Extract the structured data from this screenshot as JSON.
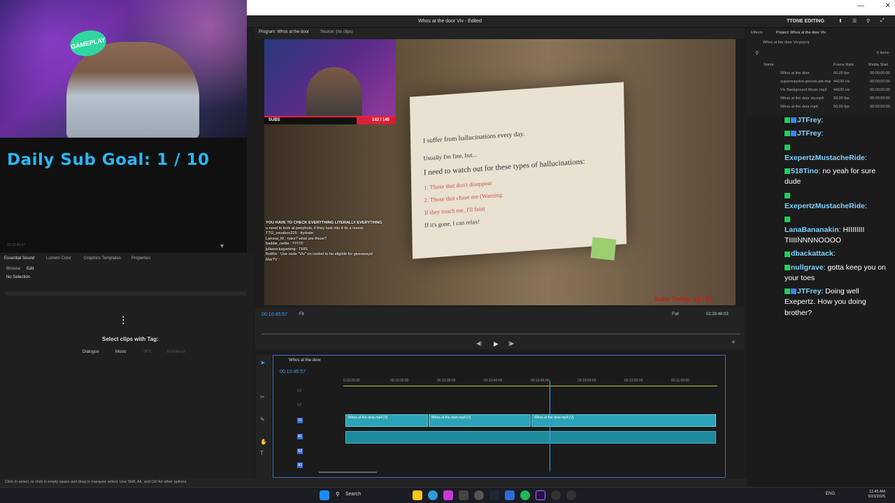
{
  "webcam": {
    "logo_text": "GAMEPLAY",
    "subgoal": "Daily Sub Goal:  1 / 10"
  },
  "left_timecode": "00:10:45:57",
  "window": {
    "title": "Whos at the door Viv - Edited",
    "workspace": "TTONE EDITING"
  },
  "program_monitor": {
    "tab_program": "Program: Whos at the door",
    "tab_source": "Source: (no clips)",
    "timecode": "00:10:45:57",
    "fit": "Fit",
    "quality": "Full",
    "duration": "01:26:48:03"
  },
  "overlay": {
    "subs_label": "SUBS",
    "subs_count": "143 / 145",
    "note_lines": [
      "I suffer from hallucinations every day.",
      "Usually I'm fine, but...",
      "I need to watch out for these types of hallucinations:",
      "1. Those that don't disappear",
      "2. Those that chase me (Warning",
      "If they touch me, I'll faint",
      "If it's gone, I can relax!"
    ],
    "subs_today": "Subs Today: 11 / 20",
    "chat_lines": [
      "YOU HAVE TO CHECK EVERYTHING LITERALLY EVERYTHING",
      "u need to look at peephole, if they look into it its a noooo",
      "TTG_zavaboo225 : ttydrate",
      "Larissa_M : rules? what are those?",
      "baddie_nettie : !!!!!!!!!!",
      "juliasocksgaming : THIS",
      "BotRix : Use code \"Viv\" on roobet to be eligible for giveaways!",
      "MarTV : "
    ]
  },
  "essential_sound": {
    "tabs": [
      "Essential Sound",
      "Lumetri Color",
      "Graphics Templates",
      "Properties"
    ],
    "subtabs": [
      "Browse",
      "Edit"
    ],
    "no_selection": "No Selection",
    "select_text": "Select clips with Tag:",
    "tags": [
      "Dialogue",
      "Music",
      "SFX",
      "Ambience"
    ]
  },
  "project": {
    "tabs": [
      "Effects",
      "Project: Whos at the door Viv"
    ],
    "file": "Whos at the door Viv.prproj",
    "items_count": "5 items",
    "columns": [
      "Name",
      "Frame Rate",
      "Media Start"
    ],
    "rows": [
      [
        "Whos at the door",
        "60.00 fps",
        "00:00:00:00"
      ],
      [
        "supermassive-person-ple-mai",
        "44100 Hz",
        "00:00:00:00"
      ],
      [
        "Viv Background Music.mp3",
        "44100 Hz",
        "00:00:00:00"
      ],
      [
        "Whos at the door viv.mp4",
        "60.00 fps",
        "00:00:00:00"
      ],
      [
        "Whos at the door.mp4",
        "60.00 fps",
        "00:00:00:00"
      ]
    ]
  },
  "timeline": {
    "sequence": "Whos at the door",
    "timecode": "00:10:45:57",
    "ruler": [
      "0:10:25:00",
      "00:10:30:00",
      "00:10:35:00",
      "00:10:40:00",
      "00:10:45:00",
      "00:10:50:00",
      "00:10:55:00",
      "00:11:00:00"
    ],
    "tracks": [
      "V3",
      "V2",
      "V1",
      "A1",
      "A2",
      "A3"
    ],
    "clip_names": [
      "Whos at the door.mp4 [V]",
      "Whos at the door.mp4 [V]",
      "Whos at the door.mp4 [V]"
    ]
  },
  "chat": [
    {
      "user": "JTFrey",
      "color": "#7dd3fc",
      "text": ""
    },
    {
      "user": "JTFrey",
      "color": "#7dd3fc",
      "text": ""
    },
    {
      "user": "ExepertzMustacheRide",
      "color": "#7dd3fc",
      "text": ""
    },
    {
      "user": "518Tino",
      "color": "#7dd3fc",
      "text": "no yeah for sure dude"
    },
    {
      "user": "ExepertzMustacheRide",
      "color": "#7dd3fc",
      "text": ""
    },
    {
      "user": "LanaBananakin",
      "color": "#7dd3fc",
      "text": "HIIIIIIII TIIIINNNNOOOO"
    },
    {
      "user": "dbackattack",
      "color": "#7dd3fc",
      "text": ""
    },
    {
      "user": "nullgrave",
      "color": "#7dd3fc",
      "text": "gotta keep you on your toes"
    },
    {
      "user": "JTFrey",
      "color": "#7dd3fc",
      "text": "Doing well Exepertz. How you doing brother?"
    }
  ],
  "status_text": "Click to select, or click in empty space and drag to marquee select. Use Shift, Alt, and Ctrl for other options.",
  "taskbar": {
    "search": "Search",
    "lang": "ENG",
    "time": "11:45 AM",
    "date": "9/23/2025"
  },
  "colors": {
    "accent": "#29b6f6",
    "clip": "#2aa3b8",
    "playhead": "#3aa0ff",
    "chat_name": "#7dd3fc"
  }
}
